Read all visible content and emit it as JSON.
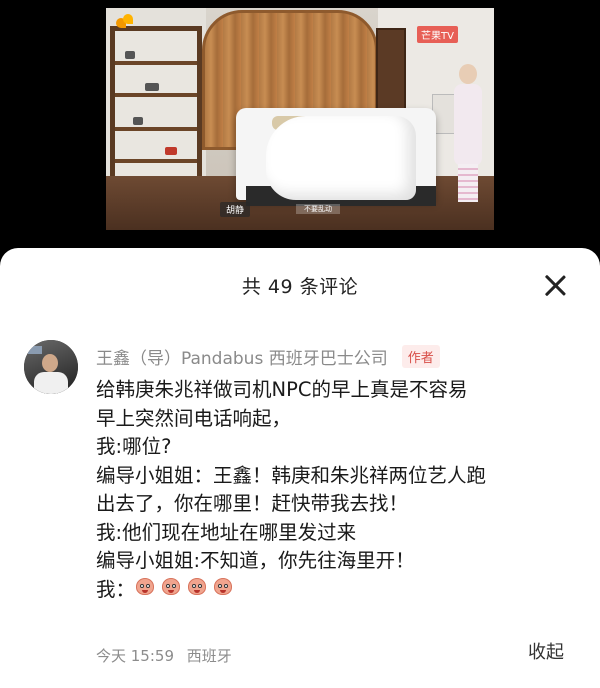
{
  "video": {
    "watermark": "芒果TV",
    "caption_name": "胡静",
    "caption_note": "不要乱动"
  },
  "comments_sheet": {
    "title": "共 49 条评论",
    "collapse_label": "收起"
  },
  "comment": {
    "author": "王鑫（导）Pandabus 西班牙巴士公司",
    "author_tag": "作者",
    "lines": [
      "给韩庚朱兆祥做司机NPC的早上真是不容易",
      "早上突然间电话响起，",
      "我:哪位?",
      "编导小姐姐：王鑫！韩庚和朱兆祥两位艺人跑",
      "出去了，你在哪里！赶快带我去找！",
      "我:他们现在地址在哪里发过来",
      "编导小姐姐:不知道，你先往海里开！"
    ],
    "last_line_prefix": "我：",
    "emoji_count": 4,
    "time": "今天 15:59",
    "location": "西班牙"
  },
  "colors": {
    "author_name": "#8a8a8a",
    "author_tag_text": "#d8504a",
    "author_tag_bg": "#fdeceb",
    "body_text": "#1a1a1a",
    "meta_text": "#8c8c8c"
  }
}
